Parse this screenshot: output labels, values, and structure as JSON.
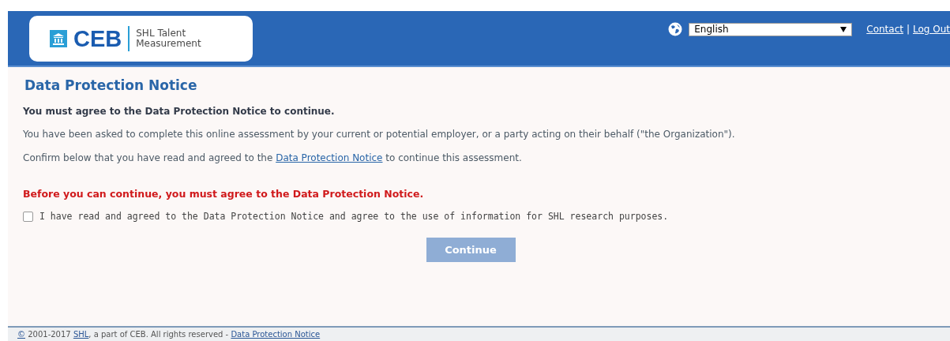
{
  "header": {
    "logo": {
      "brand": "CEB",
      "tagline_1": "SHL Talent",
      "tagline_2": "Measurement"
    },
    "language_select": {
      "value": "English"
    },
    "links": [
      "Contact",
      "Log Out"
    ],
    "separator": "|"
  },
  "notice": {
    "title": "Data Protection Notice",
    "intro": "You must agree to the Data Protection Notice to continue.",
    "paragraph": "You have been asked to complete this online assessment by your current or potential employer, or a party acting on their behalf (\"the Organization\").",
    "confirm": {
      "before": "Confirm below that you have read and agreed to the ",
      "link": "Data Protection Notice",
      "after": " to continue this assessment."
    },
    "warning": "Before you can continue, you must agree to the Data Protection Notice.",
    "agreement": {
      "label": "I have read and agreed to the Data Protection Notice and agree to the use of information for SHL research purposes.",
      "checked": false
    },
    "continue_button": {
      "label": "Continue",
      "disabled": true
    }
  },
  "footer": {
    "copyright_link": "©",
    "years": " 2001-2017 ",
    "company_link": "SHL",
    "rights": ", a part of CEB. All rights reserved - ",
    "notice_link": "Data Protection Notice"
  }
}
